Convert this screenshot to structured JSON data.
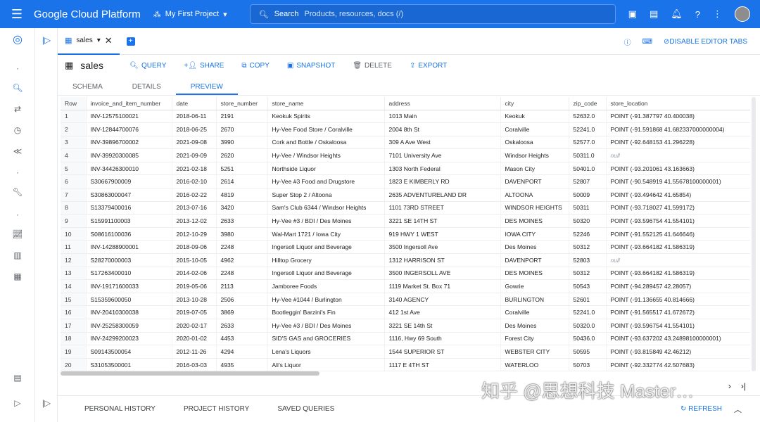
{
  "header": {
    "brand": "Google Cloud Platform",
    "project": "My First Project",
    "search_label": "Search",
    "search_placeholder": "Products, resources, docs (/)"
  },
  "tab": {
    "label": "sales"
  },
  "tab_actions": {
    "disable_editor_tabs": "DISABLE EDITOR TABS"
  },
  "toolbar": {
    "table_name": "sales",
    "query": "QUERY",
    "share": "SHARE",
    "copy": "COPY",
    "snapshot": "SNAPSHOT",
    "delete": "DELETE",
    "export": "EXPORT"
  },
  "subtabs": [
    "SCHEMA",
    "DETAILS",
    "PREVIEW"
  ],
  "table": {
    "columns": [
      "Row",
      "invoice_and_item_number",
      "date",
      "store_number",
      "store_name",
      "address",
      "city",
      "zip_code",
      "store_location"
    ],
    "rows": [
      [
        "1",
        "INV-12575100021",
        "2018-06-11",
        "2191",
        "Keokuk Spirits",
        "1013 Main",
        "Keokuk",
        "52632.0",
        "POINT (-91.387797 40.400038)"
      ],
      [
        "2",
        "INV-12844700076",
        "2018-06-25",
        "2670",
        "Hy-Vee Food Store / Coralville",
        "2004 8th  St",
        "Coralville",
        "52241.0",
        "POINT (-91.591868 41.682337000000004)"
      ],
      [
        "3",
        "INV-39896700002",
        "2021-09-08",
        "3990",
        "Cork and Bottle / Oskaloosa",
        "309 A Ave West",
        "Oskaloosa",
        "52577.0",
        "POINT (-92.648153 41.296228)"
      ],
      [
        "4",
        "INV-39920300085",
        "2021-09-09",
        "2620",
        "Hy-Vee / Windsor Heights",
        "7101 University Ave",
        "Windsor Heights",
        "50311.0",
        "null"
      ],
      [
        "5",
        "INV-34426300010",
        "2021-02-18",
        "5251",
        "Northside Liquor",
        "1303 North Federal",
        "Mason City",
        "50401.0",
        "POINT (-93.201061 43.163663)"
      ],
      [
        "6",
        "S30667900009",
        "2016-02-10",
        "2614",
        "Hy-Vee #3 Food and Drugstore",
        "1823 E KIMBERLY RD",
        "DAVENPORT",
        "52807",
        "POINT (-90.548919 41.55678100000001)"
      ],
      [
        "7",
        "S30863000047",
        "2016-02-22",
        "4819",
        "Super Stop 2 / Altoona",
        "2635 ADVENTURELAND DR",
        "ALTOONA",
        "50009",
        "POINT (-93.494642 41.65854)"
      ],
      [
        "8",
        "S13379400016",
        "2013-07-16",
        "3420",
        "Sam's Club 6344 / Windsor Heights",
        "1101  73RD STREET",
        "WINDSOR HEIGHTS",
        "50311",
        "POINT (-93.718027 41.599172)"
      ],
      [
        "9",
        "S15991100003",
        "2013-12-02",
        "2633",
        "Hy-Vee #3 / BDI / Des Moines",
        "3221 SE 14TH ST",
        "DES MOINES",
        "50320",
        "POINT (-93.596754 41.554101)"
      ],
      [
        "10",
        "S08616100036",
        "2012-10-29",
        "3980",
        "Wal-Mart 1721 / Iowa City",
        "919 HWY 1 WEST",
        "IOWA CITY",
        "52246",
        "POINT (-91.552125 41.646646)"
      ],
      [
        "11",
        "INV-14288900001",
        "2018-09-06",
        "2248",
        "Ingersoll Liquor and Beverage",
        "3500 Ingersoll Ave",
        "Des Moines",
        "50312",
        "POINT (-93.664182 41.586319)"
      ],
      [
        "12",
        "S28270000003",
        "2015-10-05",
        "4962",
        "Hilltop Grocery",
        "1312 HARRISON ST",
        "DAVENPORT",
        "52803",
        "null"
      ],
      [
        "13",
        "S17263400010",
        "2014-02-06",
        "2248",
        "Ingersoll Liquor and Beverage",
        "3500 INGERSOLL AVE",
        "DES MOINES",
        "50312",
        "POINT (-93.664182 41.586319)"
      ],
      [
        "14",
        "INV-19171600033",
        "2019-05-06",
        "2113",
        "Jamboree Foods",
        "1119 Market St. Box 71",
        "Gowrie",
        "50543",
        "POINT (-94.289457 42.28057)"
      ],
      [
        "15",
        "S15359600050",
        "2013-10-28",
        "2506",
        "Hy-Vee #1044 / Burlington",
        "3140 AGENCY",
        "BURLINGTON",
        "52601",
        "POINT (-91.136655 40.814666)"
      ],
      [
        "16",
        "INV-20410300038",
        "2019-07-05",
        "3869",
        "Bootleggin' Barzini's Fin",
        "412  1st Ave",
        "Coralville",
        "52241.0",
        "POINT (-91.565517 41.672672)"
      ],
      [
        "17",
        "INV-25258300059",
        "2020-02-17",
        "2633",
        "Hy-Vee #3 / BDI / Des Moines",
        "3221 SE 14th St",
        "Des Moines",
        "50320.0",
        "POINT (-93.596754 41.554101)"
      ],
      [
        "18",
        "INV-24299200023",
        "2020-01-02",
        "4453",
        "SID'S GAS and GROCERIES",
        "1116, Hwy 69 South",
        "Forest City",
        "50436.0",
        "POINT (-93.637202 43.24898100000001)"
      ],
      [
        "19",
        "S09143500054",
        "2012-11-26",
        "4294",
        "Lena's Liquors",
        "1544 SUPERIOR ST",
        "WEBSTER CITY",
        "50595",
        "POINT (-93.815849 42.46212)"
      ],
      [
        "20",
        "S31053500001",
        "2016-03-03",
        "4935",
        "Ali's Liquor",
        "1117 E 4TH ST",
        "WATERLOO",
        "50703",
        "POINT (-92.332774 42.507683)"
      ]
    ]
  },
  "bottom_tabs": [
    "PERSONAL HISTORY",
    "PROJECT HISTORY",
    "SAVED QUERIES"
  ],
  "refresh_label": "REFRESH",
  "watermark": "知乎 @思想科技 Master…"
}
